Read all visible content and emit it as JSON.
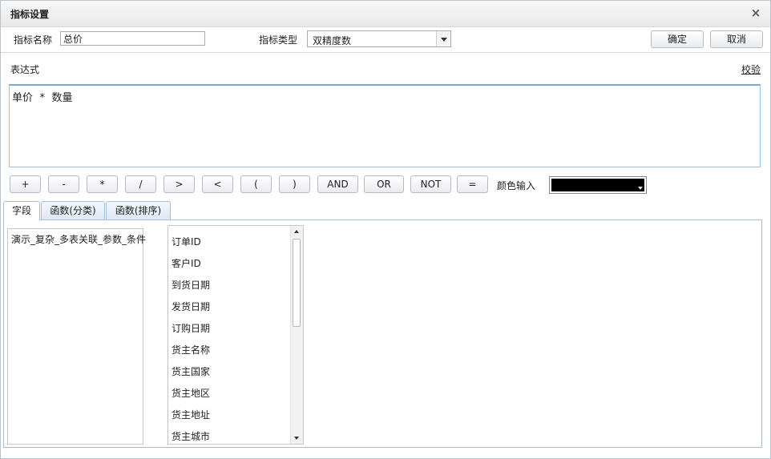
{
  "dialog": {
    "title": "指标设置",
    "close_symbol": "×"
  },
  "form": {
    "name_label": "指标名称",
    "name_value": "总价",
    "type_label": "指标类型",
    "type_value": "双精度数",
    "ok_label": "确定",
    "cancel_label": "取消"
  },
  "expression": {
    "label": "表达式",
    "validate_label": "校验",
    "value": "单价 * 数量"
  },
  "operators": [
    "+",
    "-",
    "*",
    "/",
    ">",
    "<",
    "(",
    ")",
    "AND",
    "OR",
    "NOT",
    "="
  ],
  "color": {
    "label": "颜色输入",
    "value": "#000000"
  },
  "tabs": [
    {
      "label": "字段",
      "active": true
    },
    {
      "label": "函数(分类)",
      "active": false
    },
    {
      "label": "函数(排序)",
      "active": false
    }
  ],
  "tables": [
    "演示_复杂_多表关联_参数_条件"
  ],
  "fields": [
    "订单ID",
    "客户ID",
    "到货日期",
    "发货日期",
    "订购日期",
    "货主名称",
    "货主国家",
    "货主地区",
    "货主地址",
    "货主城市"
  ]
}
